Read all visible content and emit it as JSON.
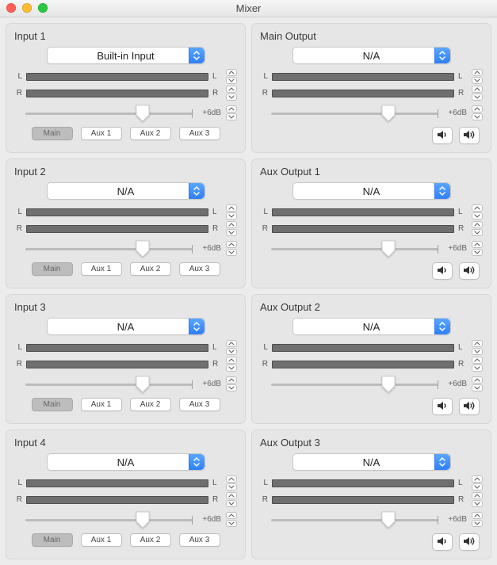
{
  "window": {
    "title": "Mixer"
  },
  "channel_labels": {
    "L": "L",
    "R": "R"
  },
  "db_label": "+6dB",
  "route_buttons": {
    "main": "Main",
    "aux1": "Aux 1",
    "aux2": "Aux 2",
    "aux3": "Aux 3"
  },
  "inputs": [
    {
      "title": "Input 1",
      "select": "Built-in Input",
      "main_selected": true
    },
    {
      "title": "Input 2",
      "select": "N/A",
      "main_selected": true
    },
    {
      "title": "Input 3",
      "select": "N/A",
      "main_selected": true
    },
    {
      "title": "Input 4",
      "select": "N/A",
      "main_selected": true
    }
  ],
  "outputs": [
    {
      "title": "Main Output",
      "select": "N/A"
    },
    {
      "title": "Aux Output 1",
      "select": "N/A"
    },
    {
      "title": "Aux Output 2",
      "select": "N/A"
    },
    {
      "title": "Aux Output 3",
      "select": "N/A"
    }
  ],
  "slider": {
    "thumb_pct": 70,
    "tick1_pct": 70,
    "tick2_pct": 100
  }
}
